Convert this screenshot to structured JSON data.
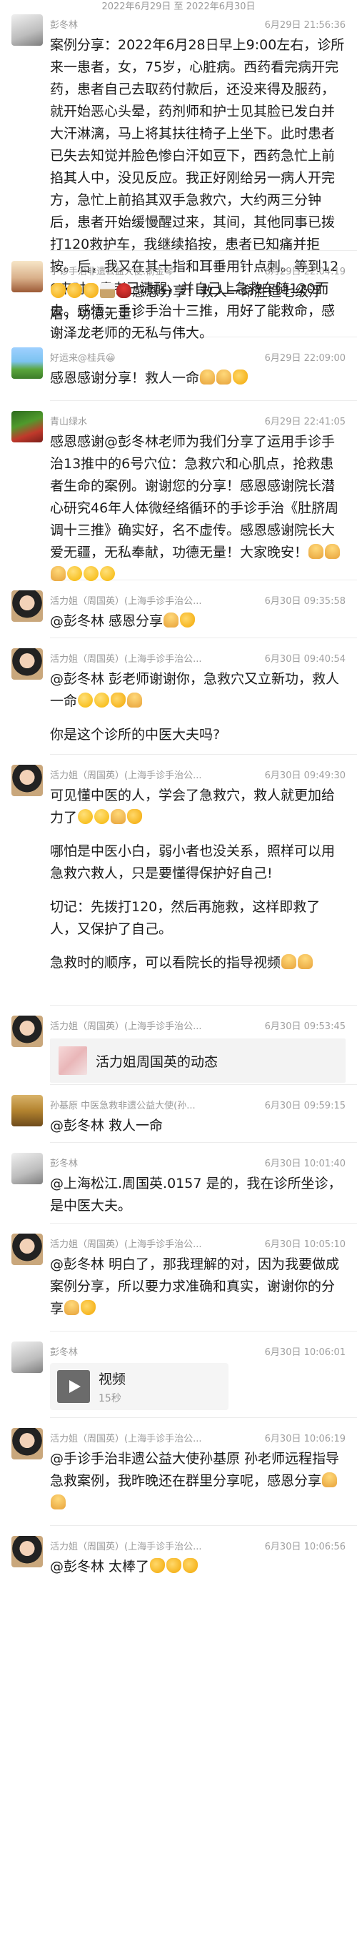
{
  "date_range": "2022年6月29日 至 2022年6月30日",
  "messages": [
    {
      "name": "彭冬林",
      "time": "6月29日 21:56:36",
      "paras": [
        "案例分享：2022年6月28日早上9:00左右，诊所来一患者，女，75岁，心脏病。西药看完病开完药，患者自己去取药付款后，还没来得及服药，就开始恶心头晕，药剂师和护士见其脸已发白并大汗淋漓，马上将其扶往椅子上坐下。此时患者已失去知觉并脸色惨白汗如豆下，西药急忙上前掐其人中，没见反应。我正好刚给另一病人开完方，急忙上前掐其双手急救穴，大约两三分钟后，患者开始缓慢醒过来，其间，其他同事已拨打120救护车，我继续掐按，患者已知痛并拒按。后，我又在其十指和耳垂用针点刺。等到120来时，患者已清醒，并自己上急救车随120而去。感悟：手诊手治十三推，用好了能救命，感谢泽龙老师的无私与伟大。"
      ]
    },
    {
      "name": "手诊手治非遗公益大使.俞金琴",
      "time": "6月29日 22:04:19",
      "paras": [
        "感恩分享！救人一命胜造七级浮屠，功德无量！"
      ]
    },
    {
      "name": "好运来@桂兵😀",
      "time": "6月29日 22:09:00",
      "paras": [
        "感恩感谢分享！救人一命"
      ]
    },
    {
      "name": "青山绿水",
      "time": "6月29日 22:41:05",
      "paras": [
        "感恩感谢@彭冬林老师为我们分享了运用手诊手治13推中的6号穴位：急救穴和心肌点，抢救患者生命的案例。谢谢您的分享！感恩感谢院长潜心研究46年人体微经络循环的手诊手治《肚脐周调十三推》确实好，名不虚传。感恩感谢院长大爱无疆，无私奉献，功德无量！大家晚安！"
      ]
    },
    {
      "name": "活力姐（周国英）(上海手诊手治公...",
      "time": "6月30日 09:35:58",
      "paras": [
        "@彭冬林 感恩分享"
      ]
    },
    {
      "name": "活力姐（周国英）(上海手诊手治公...",
      "time": "6月30日 09:40:54",
      "paras": [
        "@彭冬林 彭老师谢谢你，急救穴又立新功，救人一命",
        "你是这个诊所的中医大夫吗?"
      ]
    },
    {
      "name": "活力姐（周国英）(上海手诊手治公...",
      "time": "6月30日 09:49:30",
      "paras": [
        "可见懂中医的人，学会了急救穴，救人就更加给力了",
        "哪怕是中医小白，弱小者也没关系，照样可以用急救穴救人，只是要懂得保护好自己!",
        "切记：先拨打120，然后再施救，这样即救了人，又保护了自己。",
        "急救时的顺序，可以看院长的指导视频"
      ]
    },
    {
      "name": "活力姐（周国英）(上海手诊手治公...",
      "time": "6月30日 09:53:45",
      "card_text": "活力姐周国英的动态"
    },
    {
      "name": "孙基原 中医急救非遗公益大使(孙...",
      "time": "6月30日 09:59:15",
      "paras": [
        "@彭冬林 救人一命"
      ]
    },
    {
      "name": "彭冬林",
      "time": "6月30日 10:01:40",
      "paras": [
        "@上海松江.周国英.0157 是的，我在诊所坐诊，是中医大夫。"
      ]
    },
    {
      "name": "活力姐（周国英）(上海手诊手治公...",
      "time": "6月30日 10:05:10",
      "paras": [
        "@彭冬林 明白了，那我理解的对，因为我要做成案例分享，所以要力求准确和真实，谢谢你的分享"
      ]
    },
    {
      "name": "彭冬林",
      "time": "6月30日 10:06:01",
      "video_title": "视频",
      "video_duration": "15秒"
    },
    {
      "name": "活力姐（周国英）(上海手诊手治公...",
      "time": "6月30日 10:06:19",
      "paras": [
        "@手诊手治非遗公益大使孙基原 孙老师远程指导急救案例，我昨晚还在群里分享呢，感恩分享"
      ]
    },
    {
      "name": "活力姐（周国英）(上海手诊手治公...",
      "time": "6月30日 10:06:56",
      "paras": [
        "@彭冬林 太棒了"
      ]
    }
  ],
  "icons": {
    "thumb": "thumbs-up-emoji",
    "pray": "folded-hands-emoji",
    "smile": "smiling-face-emoji",
    "rose": "rose-emoji",
    "cake": "cake-emoji",
    "play": "play-icon"
  }
}
